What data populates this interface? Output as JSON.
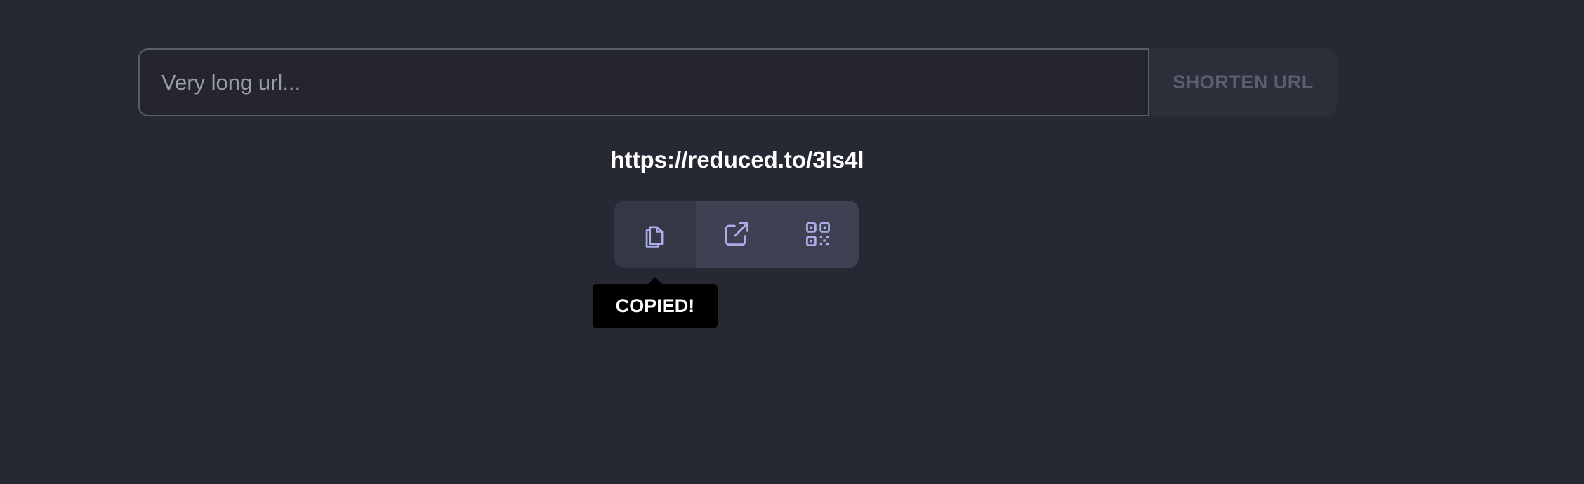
{
  "form": {
    "url_input_placeholder": "Very long url...",
    "url_input_value": "",
    "shorten_label": "SHORTEN URL"
  },
  "result": {
    "short_url": "https://reduced.to/3ls4l"
  },
  "actions": [
    {
      "name": "copy",
      "icon": "copy-icon"
    },
    {
      "name": "open",
      "icon": "external-link-icon"
    },
    {
      "name": "qr",
      "icon": "qr-code-icon"
    }
  ],
  "tooltip": {
    "text": "COPIED!"
  },
  "colors": {
    "background": "#262834",
    "icon": "#a9aee6",
    "button_group": "#3f4152",
    "tooltip_bg": "#000000"
  }
}
